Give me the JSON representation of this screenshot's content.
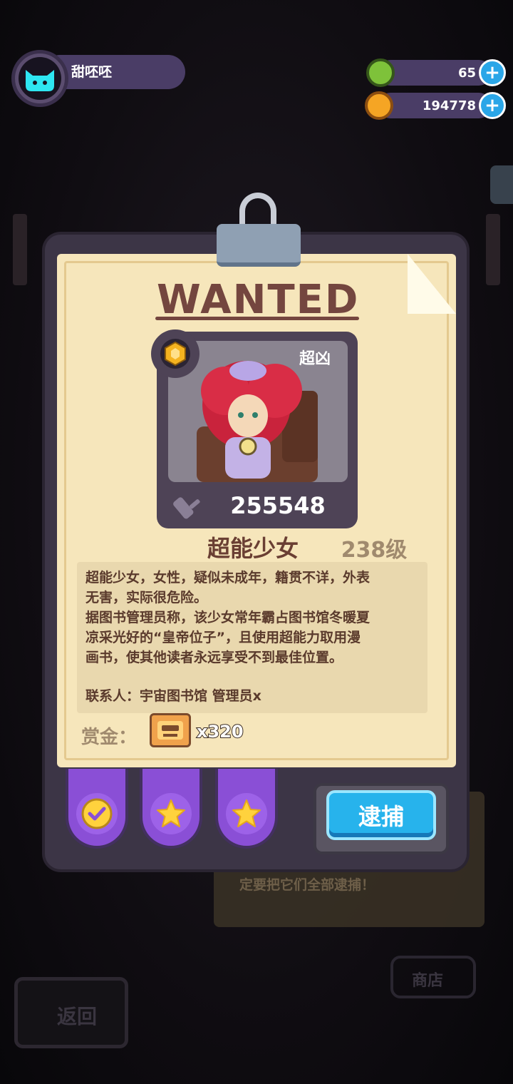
{
  "player": {
    "name": "甜呸呸"
  },
  "currencies": [
    {
      "name": "gem",
      "value": "65"
    },
    {
      "name": "coin",
      "value": "194778"
    }
  ],
  "wanted": {
    "title": "WANTED",
    "tag": "超凶",
    "power": "255548",
    "name": "超能少女",
    "level": "238级",
    "description": [
      "超能少女，女性，疑似未成年，籍贯不详，外表",
      "无害，实际很危险。",
      "据图书管理员称，该少女常年霸占图书馆冬暖夏",
      "凉采光好的“皇帝位子”，且使用超能力取用漫",
      "画书，使其他读者永远享受不到最佳位置。",
      "",
      "联系人：宇宙图书馆 管理员x"
    ],
    "reward_label": "赏金：",
    "reward_count": "x320"
  },
  "tabs": [
    {
      "icon": "check-icon"
    },
    {
      "icon": "star-icon"
    },
    {
      "icon": "star-icon"
    }
  ],
  "action": {
    "arrest_label": "逮捕"
  },
  "background": {
    "note_lines": [
      "…………………，……",
      "定要把它们全部逮捕！"
    ],
    "back_label": "返回",
    "shop_label": "商店"
  },
  "colors": {
    "accent": "#27b3ec",
    "tab": "#8a4fd6",
    "paper": "#f6e6bb",
    "title": "#74463f"
  }
}
